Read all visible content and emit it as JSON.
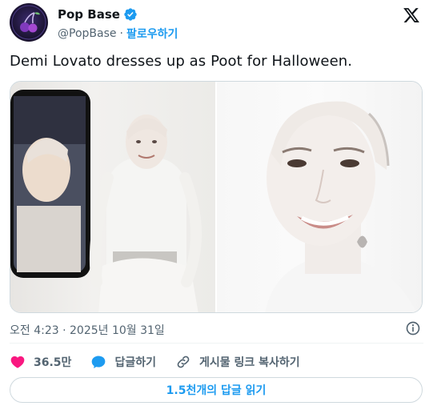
{
  "author": {
    "display_name": "Pop Base",
    "handle": "@PopBase",
    "separator": "·",
    "follow_label": "팔로우하기"
  },
  "tweet": {
    "text": "Demi Lovato dresses up as Poot for Halloween.",
    "timestamp": "오전 4:23 · 2025년 10월 31일"
  },
  "actions": {
    "likes": "36.5만",
    "reply_label": "답글하기",
    "copy_link_label": "게시물 링크 복사하기"
  },
  "read_replies_label": "1.5천개의 답글 읽기",
  "colors": {
    "accent": "#1d9bf0",
    "like": "#f91880",
    "text": "#0f1419",
    "muted": "#536471"
  },
  "icons": {
    "verified": "verified-badge-icon",
    "x_logo": "x-logo-icon",
    "info": "info-icon",
    "like": "heart-icon",
    "reply": "reply-bubble-icon",
    "copy_link": "link-icon"
  }
}
